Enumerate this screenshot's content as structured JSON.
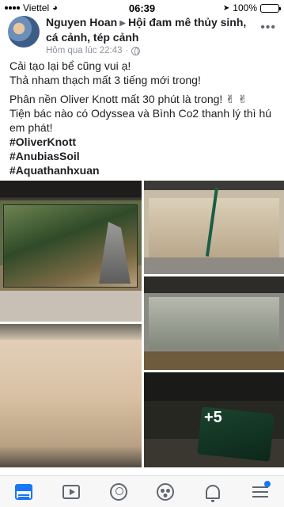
{
  "status_bar": {
    "carrier": "Viettel",
    "time": "06:39",
    "battery": "100%",
    "battery_level": 1.0
  },
  "post": {
    "author": "Nguyen Hoan",
    "group": "Hội đam mê thủy sinh, cá cảnh, tép cảnh",
    "timestamp": "Hôm qua lúc 22:43",
    "privacy_icon": "globe-icon",
    "lines": [
      "Cải tạo lại bể cũng vui ạ!",
      "Thả nham thạch mất 3 tiếng mới trong!",
      "Phân nền Oliver Knott mất 30 phút là trong! ✌ ✌",
      "Tiện bác nào có Odyssea và Bình Co2 thanh lý thì hú em phát!"
    ],
    "hashtags": [
      "#OliverKnott",
      "#AnubiasSoil",
      "#Aquathanhxuan"
    ],
    "more_photos": "+5"
  },
  "tabbar": {
    "items": [
      "news-feed-icon",
      "video-icon",
      "profile-icon",
      "groups-icon",
      "notifications-icon",
      "menu-icon"
    ],
    "accent": "#1877f2",
    "icon_color": "#606770"
  }
}
